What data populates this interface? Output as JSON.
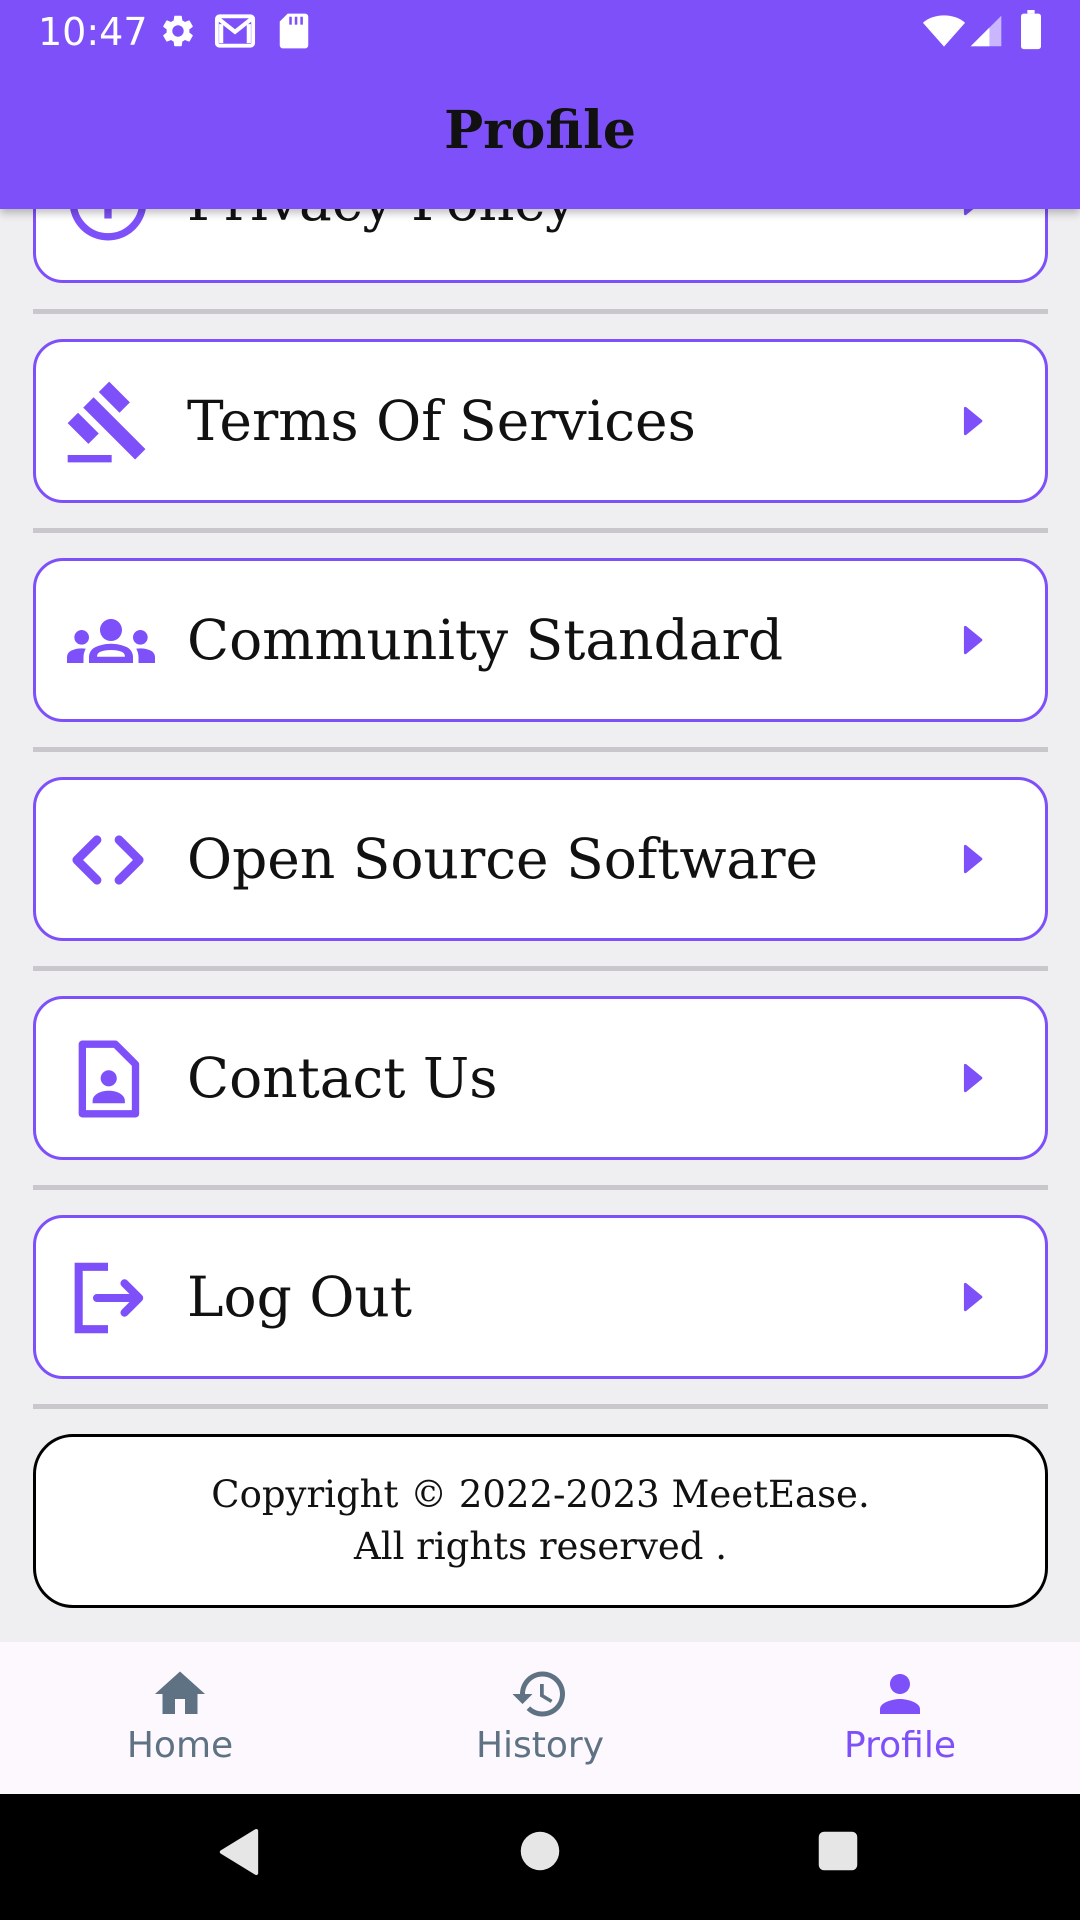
{
  "status_bar": {
    "time": "10:47",
    "left_icons": [
      "settings-icon",
      "gmail-icon",
      "sd-card-icon"
    ],
    "right_icons": [
      "wifi-icon",
      "cell-signal-icon",
      "battery-icon"
    ]
  },
  "app_bar": {
    "title": "Profile"
  },
  "menu": {
    "items": [
      {
        "label": "Privacy Policy",
        "icon": "info-icon"
      },
      {
        "label": "Terms Of Services",
        "icon": "gavel-icon"
      },
      {
        "label": "Community Standard",
        "icon": "groups-icon"
      },
      {
        "label": "Open Source Software",
        "icon": "code-icon"
      },
      {
        "label": "Contact Us",
        "icon": "contact-page-icon"
      },
      {
        "label": "Log Out",
        "icon": "logout-icon"
      }
    ],
    "arrow_icon": "arrow-right-icon"
  },
  "footer": {
    "line1": "Copyright © 2022-2023 MeetEase.",
    "line2": "All rights reserved ."
  },
  "bottom_nav": {
    "items": [
      {
        "label": "Home",
        "icon": "home-icon",
        "active": false
      },
      {
        "label": "History",
        "icon": "history-icon",
        "active": false
      },
      {
        "label": "Profile",
        "icon": "person-icon",
        "active": true
      }
    ]
  },
  "colors": {
    "accent": "#7d50fa",
    "background": "#efeef0",
    "nav_inactive": "#5e7283",
    "nav_active": "#7d50fa",
    "card_border": "#7d50fa"
  }
}
